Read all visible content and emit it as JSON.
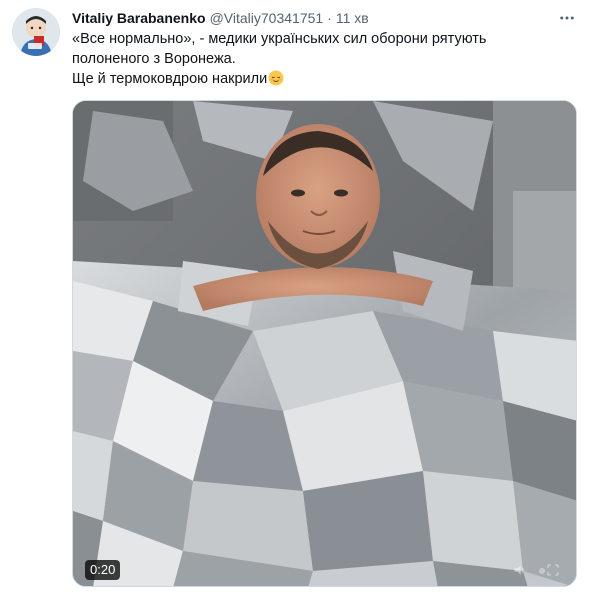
{
  "author": {
    "name": "Vitaliy Barabanenko",
    "handle": "@Vitaliy70341751",
    "time": "11 хв"
  },
  "tweet": {
    "lines": [
      "«Все нормально», - медики українських сил оборони рятують",
      "полоненого з Воронежа.",
      "Ще й термоковдрою накрили"
    ],
    "emoji": "relieved-face-emoji"
  },
  "video": {
    "duration": "0:20"
  },
  "colors": {
    "text": "#0f1419",
    "secondary": "#536471",
    "border": "#cfd9de"
  }
}
